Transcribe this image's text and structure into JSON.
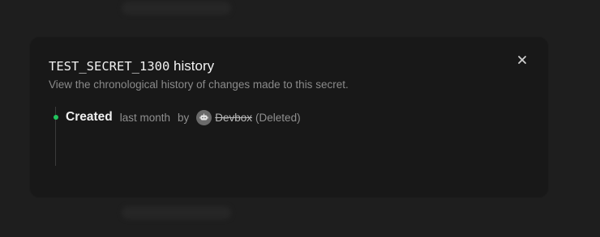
{
  "modal": {
    "secret_name": "TEST_SECRET_1300",
    "title_suffix": "history",
    "subtitle": "View the chronological history of changes made to this secret.",
    "close_label": "×"
  },
  "history": [
    {
      "event": "Created",
      "time": "last month",
      "by_label": "by",
      "actor": "Devbox",
      "actor_status": "(Deleted)",
      "actor_icon": "robot-icon",
      "dot_color": "#22c55e"
    }
  ]
}
